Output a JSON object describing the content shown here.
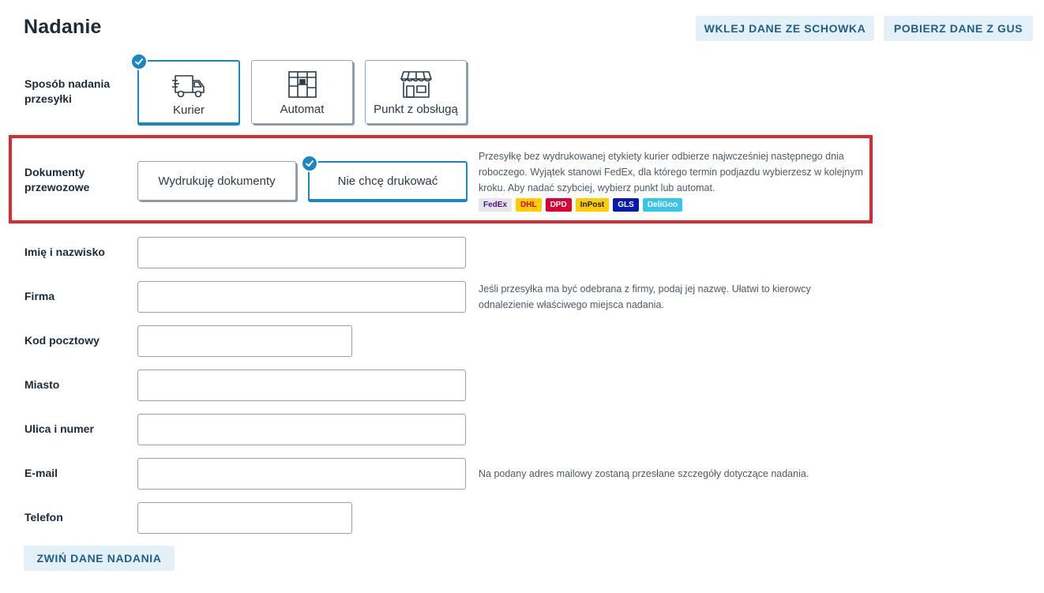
{
  "header": {
    "title": "Nadanie",
    "paste_button": "WKLEJ DANE ZE SCHOWKA",
    "gus_button": "POBIERZ DANE Z GUS"
  },
  "shipping_method": {
    "label": "Sposób nadania przesyłki",
    "options": [
      {
        "label": "Kurier",
        "icon": "courier-van-icon",
        "selected": true
      },
      {
        "label": "Automat",
        "icon": "parcel-locker-icon",
        "selected": false
      },
      {
        "label": "Punkt z obsługą",
        "icon": "service-point-shop-icon",
        "selected": false
      }
    ]
  },
  "documents": {
    "label": "Dokumenty przewozowe",
    "print_label": "Wydrukuję dokumenty",
    "no_print_label": "Nie chcę drukować",
    "selected": "no_print",
    "help": "Przesyłkę bez wydrukowanej etykiety kurier odbierze najwcześniej następnego dnia roboczego. Wyjątek stanowi FedEx, dla którego termin podjazdu wybierzesz w kolejnym kroku. Aby nadać szybciej, wybierz punkt lub automat.",
    "carriers": [
      {
        "name": "FedEx",
        "bg": "#e8e4ec",
        "color": "#4d148c"
      },
      {
        "name": "DHL",
        "bg": "#ffcc00",
        "color": "#d40511"
      },
      {
        "name": "DPD",
        "bg": "#dc0032",
        "color": "#ffffff"
      },
      {
        "name": "InPost",
        "bg": "#ffcd00",
        "color": "#1d1d1b"
      },
      {
        "name": "GLS",
        "bg": "#061ab1",
        "color": "#ffffff"
      },
      {
        "name": "DeliGoo",
        "bg": "#36c6ec",
        "color": "#ffffff"
      }
    ]
  },
  "form": {
    "name": {
      "label": "Imię i nazwisko",
      "value": ""
    },
    "company": {
      "label": "Firma",
      "value": "",
      "help": "Jeśli przesyłka ma być odebrana z firmy, podaj jej nazwę. Ułatwi to kierowcy odnalezienie właściwego miejsca nadania."
    },
    "postal_code": {
      "label": "Kod pocztowy",
      "value": ""
    },
    "city": {
      "label": "Miasto",
      "value": ""
    },
    "street": {
      "label": "Ulica i numer",
      "value": ""
    },
    "email": {
      "label": "E-mail",
      "value": "",
      "help": "Na podany adres mailowy zostaną przesłane szczegóły dotyczące nadania."
    },
    "phone": {
      "label": "Telefon",
      "value": ""
    }
  },
  "footer": {
    "collapse_button": "ZWIŃ DANE NADANIA"
  },
  "colors": {
    "accent": "#1a86c2",
    "highlight": "#e0262f",
    "button_bg": "#e4f0f8",
    "button_text": "#1d5f8a"
  }
}
